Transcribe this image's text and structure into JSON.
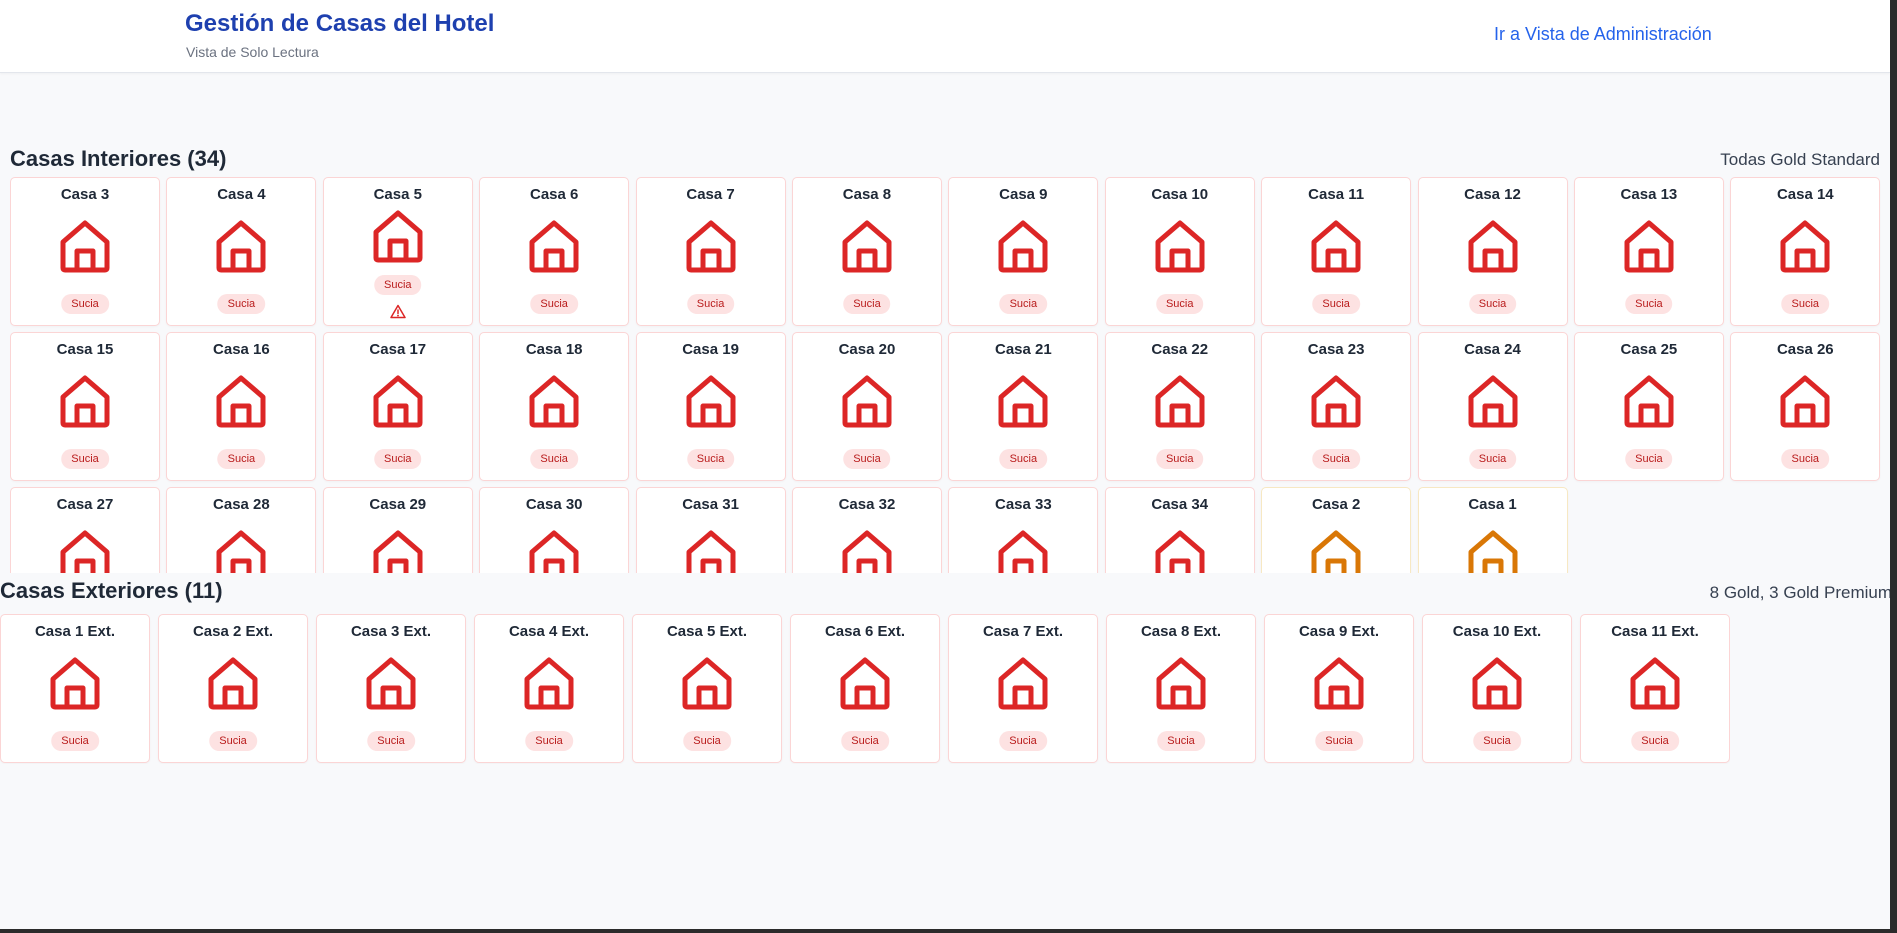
{
  "header": {
    "title": "Gestión de Casas del Hotel",
    "subtitle": "Vista de Solo Lectura",
    "admin_link": "Ir a Vista de Administración"
  },
  "colors": {
    "dirty": "#dc2626",
    "pending": "#d97706",
    "accent": "#1e40af",
    "link": "#2563eb"
  },
  "interior": {
    "title": "Casas Interiores (34)",
    "meta": "Todas Gold Standard",
    "houses": [
      {
        "label": "Casa 3",
        "status": "Sucia",
        "color": "red"
      },
      {
        "label": "Casa 4",
        "status": "Sucia",
        "color": "red"
      },
      {
        "label": "Casa 5",
        "status": "Sucia",
        "color": "red",
        "alert": true
      },
      {
        "label": "Casa 6",
        "status": "Sucia",
        "color": "red"
      },
      {
        "label": "Casa 7",
        "status": "Sucia",
        "color": "red"
      },
      {
        "label": "Casa 8",
        "status": "Sucia",
        "color": "red"
      },
      {
        "label": "Casa 9",
        "status": "Sucia",
        "color": "red"
      },
      {
        "label": "Casa 10",
        "status": "Sucia",
        "color": "red"
      },
      {
        "label": "Casa 11",
        "status": "Sucia",
        "color": "red"
      },
      {
        "label": "Casa 12",
        "status": "Sucia",
        "color": "red"
      },
      {
        "label": "Casa 13",
        "status": "Sucia",
        "color": "red"
      },
      {
        "label": "Casa 14",
        "status": "Sucia",
        "color": "red"
      },
      {
        "label": "Casa 15",
        "status": "Sucia",
        "color": "red"
      },
      {
        "label": "Casa 16",
        "status": "Sucia",
        "color": "red"
      },
      {
        "label": "Casa 17",
        "status": "Sucia",
        "color": "red"
      },
      {
        "label": "Casa 18",
        "status": "Sucia",
        "color": "red"
      },
      {
        "label": "Casa 19",
        "status": "Sucia",
        "color": "red"
      },
      {
        "label": "Casa 20",
        "status": "Sucia",
        "color": "red"
      },
      {
        "label": "Casa 21",
        "status": "Sucia",
        "color": "red"
      },
      {
        "label": "Casa 22",
        "status": "Sucia",
        "color": "red"
      },
      {
        "label": "Casa 23",
        "status": "Sucia",
        "color": "red"
      },
      {
        "label": "Casa 24",
        "status": "Sucia",
        "color": "red"
      },
      {
        "label": "Casa 25",
        "status": "Sucia",
        "color": "red"
      },
      {
        "label": "Casa 26",
        "status": "Sucia",
        "color": "red"
      },
      {
        "label": "Casa 27",
        "color": "red"
      },
      {
        "label": "Casa 28",
        "color": "red"
      },
      {
        "label": "Casa 29",
        "color": "red"
      },
      {
        "label": "Casa 30",
        "color": "red"
      },
      {
        "label": "Casa 31",
        "color": "red"
      },
      {
        "label": "Casa 32",
        "color": "red"
      },
      {
        "label": "Casa 33",
        "color": "red"
      },
      {
        "label": "Casa 34",
        "color": "red"
      },
      {
        "label": "Casa 2",
        "color": "orange"
      },
      {
        "label": "Casa 1",
        "color": "orange"
      }
    ]
  },
  "exterior": {
    "title": "Casas Exteriores (11)",
    "meta": "8 Gold, 3 Gold Premium",
    "houses": [
      {
        "label": "Casa 1 Ext.",
        "status": "Sucia",
        "color": "red"
      },
      {
        "label": "Casa 2 Ext.",
        "status": "Sucia",
        "color": "red"
      },
      {
        "label": "Casa 3 Ext.",
        "status": "Sucia",
        "color": "red"
      },
      {
        "label": "Casa 4 Ext.",
        "status": "Sucia",
        "color": "red"
      },
      {
        "label": "Casa 5 Ext.",
        "status": "Sucia",
        "color": "red"
      },
      {
        "label": "Casa 6 Ext.",
        "status": "Sucia",
        "color": "red"
      },
      {
        "label": "Casa 7 Ext.",
        "status": "Sucia",
        "color": "red"
      },
      {
        "label": "Casa 8 Ext.",
        "status": "Sucia",
        "color": "red"
      },
      {
        "label": "Casa 9 Ext.",
        "status": "Sucia",
        "color": "red"
      },
      {
        "label": "Casa 10 Ext.",
        "status": "Sucia",
        "color": "red"
      },
      {
        "label": "Casa 11 Ext.",
        "status": "Sucia",
        "color": "red"
      }
    ]
  }
}
